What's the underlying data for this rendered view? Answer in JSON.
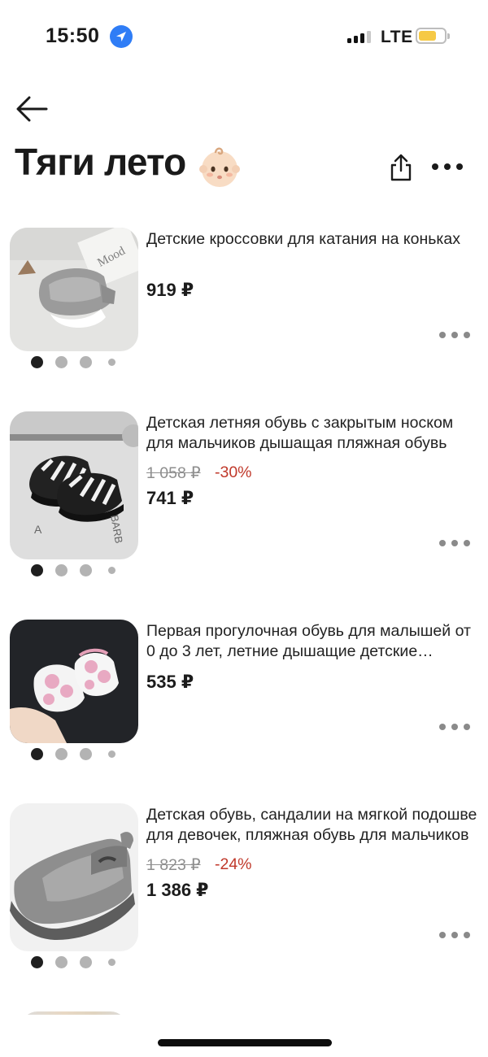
{
  "status_bar": {
    "time": "15:50",
    "network": "LTE"
  },
  "header": {
    "title": "Тяги лето"
  },
  "products": [
    {
      "title": "Детские кроссовки для катания на коньках",
      "price": "919 ₽"
    },
    {
      "title": "Детская летняя обувь с закрытым носком для мальчиков дышащая пляжная обувь",
      "old_price": "1 058 ₽",
      "discount": "-30%",
      "price": "741 ₽"
    },
    {
      "title": "Первая прогулочная обувь для малышей от 0 до 3 лет, летние дышащие детские сандалии",
      "price": "535 ₽"
    },
    {
      "title": "Детская обувь, сандалии на мягкой подошве для девочек, пляжная обувь для мальчиков",
      "old_price": "1 823 ₽",
      "discount": "-24%",
      "price": "1 386 ₽"
    }
  ],
  "colors": {
    "accent_blue": "#2f7df6",
    "discount_red": "#c0392b",
    "battery_yellow": "#f6c945"
  },
  "icons": [
    "location-icon",
    "signal-icon",
    "battery-icon",
    "back-arrow-icon",
    "baby-face-icon",
    "share-icon",
    "more-icon"
  ]
}
